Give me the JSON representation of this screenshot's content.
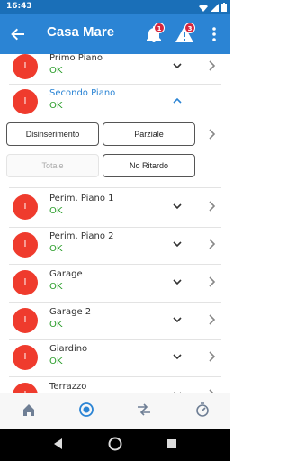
{
  "status_bar": {
    "time": "16:43"
  },
  "app_bar": {
    "title": "Casa Mare",
    "notifications_badge": "1",
    "alerts_badge": "3"
  },
  "zones": [
    {
      "name": "Primo Piano",
      "status": "OK",
      "avatar": "I"
    },
    {
      "name": "Secondo Piano",
      "status": "OK",
      "avatar": "I",
      "expanded": true
    },
    {
      "name": "Perim. Piano 1",
      "status": "OK",
      "avatar": "I"
    },
    {
      "name": "Perim. Piano 2",
      "status": "OK",
      "avatar": "I"
    },
    {
      "name": "Garage",
      "status": "OK",
      "avatar": "I"
    },
    {
      "name": "Garage 2",
      "status": "OK",
      "avatar": "I"
    },
    {
      "name": "Giardino",
      "status": "OK",
      "avatar": "I"
    },
    {
      "name": "Terrazzo",
      "status": "",
      "avatar": "I"
    }
  ],
  "actions": {
    "disinserimento": "Disinserimento",
    "parziale": "Parziale",
    "totale": "Totale",
    "no_ritardo": "No Ritardo"
  },
  "colors": {
    "appbar": "#2b84d4",
    "statusbar": "#1a6fb8",
    "avatar": "#ef3b2d",
    "ok": "#2a9d2a",
    "expanded_name": "#2b84d4"
  },
  "icons": {
    "back": "arrow-left-icon",
    "bell": "bell-icon",
    "warning": "warning-icon",
    "menu": "more-vert-icon",
    "home": "home-icon",
    "alarm": "radio-target-icon",
    "swap": "swap-arrows-icon",
    "timer": "timer-icon"
  }
}
